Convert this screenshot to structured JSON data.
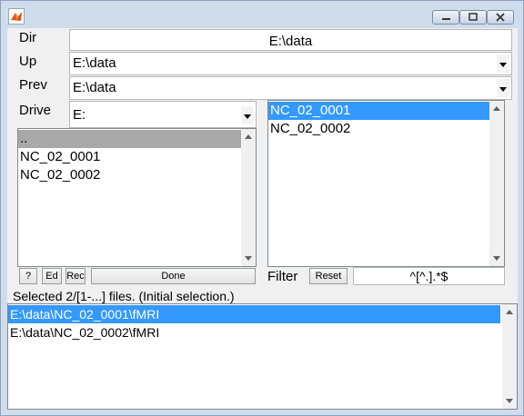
{
  "window": {
    "title_icon": "matlab-icon",
    "controls": {
      "minimize": "minimize-icon",
      "maximize": "maximize-icon",
      "close": "close-icon"
    }
  },
  "labels": {
    "dir": "Dir",
    "up": "Up",
    "prev": "Prev",
    "drive": "Drive",
    "filter": "Filter"
  },
  "dir_value": "E:\\data",
  "up_value": "E:\\data",
  "prev_value": "E:\\data",
  "drive_value": "E:",
  "dir_list": {
    "items": [
      "..",
      "NC_02_0001",
      "NC_02_0002"
    ],
    "selected_index": 0
  },
  "file_list": {
    "items": [
      "NC_02_0001",
      "NC_02_0002"
    ],
    "selected_index": 0
  },
  "buttons": {
    "help": "?",
    "edit": "Ed",
    "rec": "Rec",
    "done": "Done",
    "reset": "Reset"
  },
  "filter_value": "^[^.].*$",
  "status_text": "Selected 2/[1-...] files. (Initial selection.)",
  "selected_list": {
    "items": [
      "E:\\data\\NC_02_0001\\fMRI",
      "E:\\data\\NC_02_0002\\fMRI"
    ],
    "selected_index": 0
  },
  "colors": {
    "selection": "#3399ff",
    "frame": "#cfdcec",
    "panel": "#f0f0f0"
  }
}
